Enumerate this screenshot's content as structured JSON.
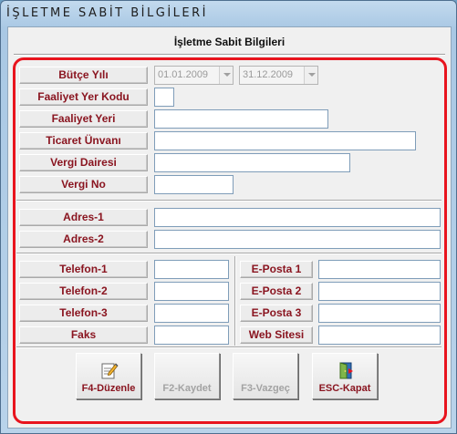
{
  "window": {
    "title": "İŞLETME SABİT BİLGİLERİ"
  },
  "form": {
    "title": "İşletme Sabit Bilgileri",
    "labels": {
      "butce_yili": "Bütçe Yılı",
      "faaliyet_yer_kodu": "Faaliyet Yer Kodu",
      "faaliyet_yeri": "Faaliyet Yeri",
      "ticaret_unvani": "Ticaret Ünvanı",
      "vergi_dairesi": "Vergi Dairesi",
      "vergi_no": "Vergi No",
      "adres1": "Adres-1",
      "adres2": "Adres-2",
      "telefon1": "Telefon-1",
      "telefon2": "Telefon-2",
      "telefon3": "Telefon-3",
      "faks": "Faks",
      "eposta1": "E-Posta 1",
      "eposta2": "E-Posta 2",
      "eposta3": "E-Posta 3",
      "web_sitesi": "Web Sitesi"
    },
    "values": {
      "butce_baslangic": "01.01.2009",
      "butce_bitis": "31.12.2009",
      "faaliyet_yer_kodu": "",
      "faaliyet_yeri": "",
      "ticaret_unvani": "",
      "vergi_dairesi": "",
      "vergi_no": "",
      "adres1": "",
      "adres2": "",
      "telefon1": "",
      "telefon2": "",
      "telefon3": "",
      "faks": "",
      "eposta1": "",
      "eposta2": "",
      "eposta3": "",
      "web_sitesi": ""
    }
  },
  "buttons": {
    "duzenle": "F4-Düzenle",
    "kaydet": "F2-Kaydet",
    "vazgec": "F3-Vazgeç",
    "kapat": "ESC-Kapat"
  },
  "colors": {
    "label_text": "#8a1520",
    "highlight_frame": "#e8141e",
    "disabled_text": "#a3a3a3"
  }
}
